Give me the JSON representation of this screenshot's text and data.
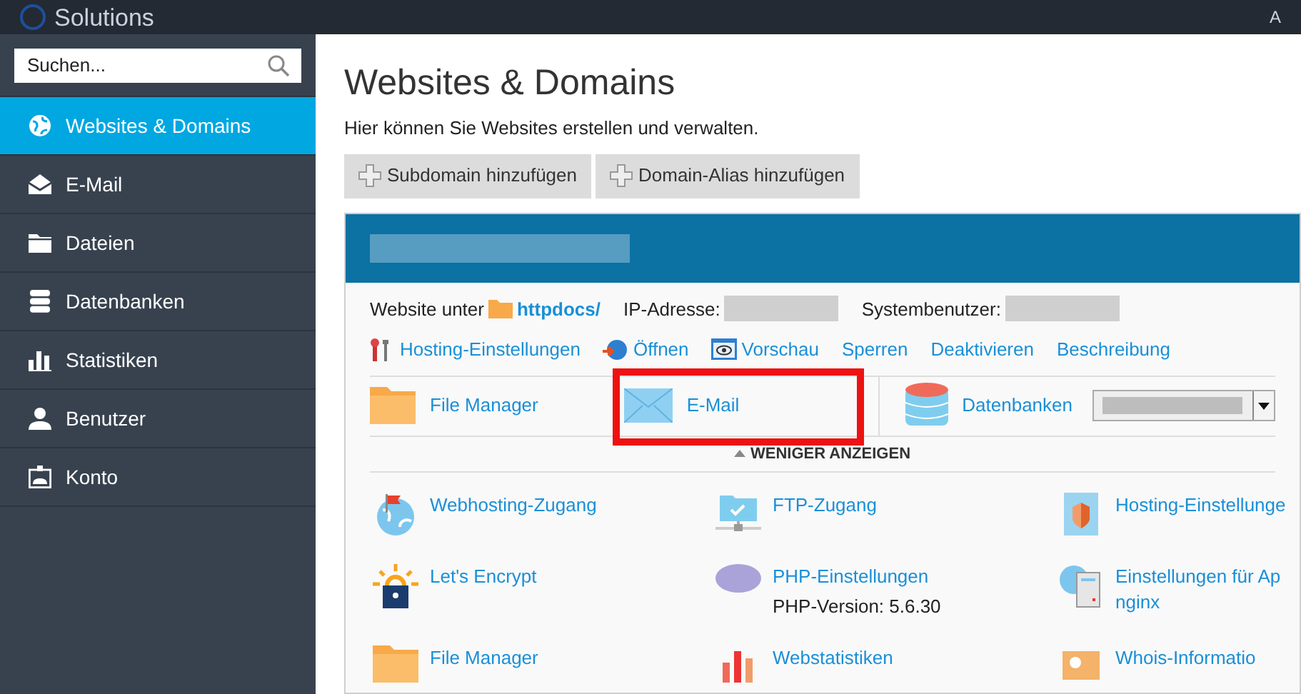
{
  "brand": {
    "logo_text": "Solutions",
    "corner_text": "A"
  },
  "sidebar": {
    "search": {
      "placeholder": "Suchen..."
    },
    "items": [
      {
        "label": "Websites & Domains",
        "selected": true
      },
      {
        "label": "E-Mail",
        "selected": false
      },
      {
        "label": "Dateien",
        "selected": false
      },
      {
        "label": "Datenbanken",
        "selected": false
      },
      {
        "label": "Statistiken",
        "selected": false
      },
      {
        "label": "Benutzer",
        "selected": false
      },
      {
        "label": "Konto",
        "selected": false
      }
    ]
  },
  "page": {
    "title": "Websites & Domains",
    "description": "Hier können Sie Websites erstellen und verwalten.",
    "buttons": [
      "Subdomain hinzufügen",
      "Domain-Alias hinzufügen"
    ]
  },
  "domain": {
    "info": [
      {
        "label": "Website unter",
        "kind": "link",
        "value": "httpdocs/"
      },
      {
        "label": "IP-Adresse:",
        "kind": "redacted"
      },
      {
        "label": "Systembenutzer:",
        "kind": "redacted"
      }
    ],
    "actions": [
      "Hosting-Einstellungen",
      "Öffnen",
      "Vorschau",
      "Sperren",
      "Deaktivieren",
      "Beschreibung"
    ],
    "tools": [
      {
        "label": "File Manager",
        "kind": "plain",
        "highlighted": false
      },
      {
        "label": "E-Mail",
        "kind": "plain",
        "highlighted": true
      },
      {
        "label": "Datenbanken",
        "kind": "dropdown",
        "highlighted": false
      }
    ],
    "toggle": {
      "label": "WENIGER ANZEIGEN",
      "expanded": true
    },
    "features": [
      {
        "label": "Webhosting-Zugang"
      },
      {
        "label": "FTP-Zugang"
      },
      {
        "label": "Hosting-Einstellunge"
      },
      {
        "label": "Let's Encrypt"
      },
      {
        "label": "PHP-Einstellungen",
        "note": "PHP-Version: 5.6.30"
      },
      {
        "label": "Einstellungen für Ap",
        "sublink": "nginx"
      },
      {
        "label": "File Manager"
      },
      {
        "label": "Webstatistiken"
      },
      {
        "label": "Whois-Informatio"
      }
    ]
  }
}
